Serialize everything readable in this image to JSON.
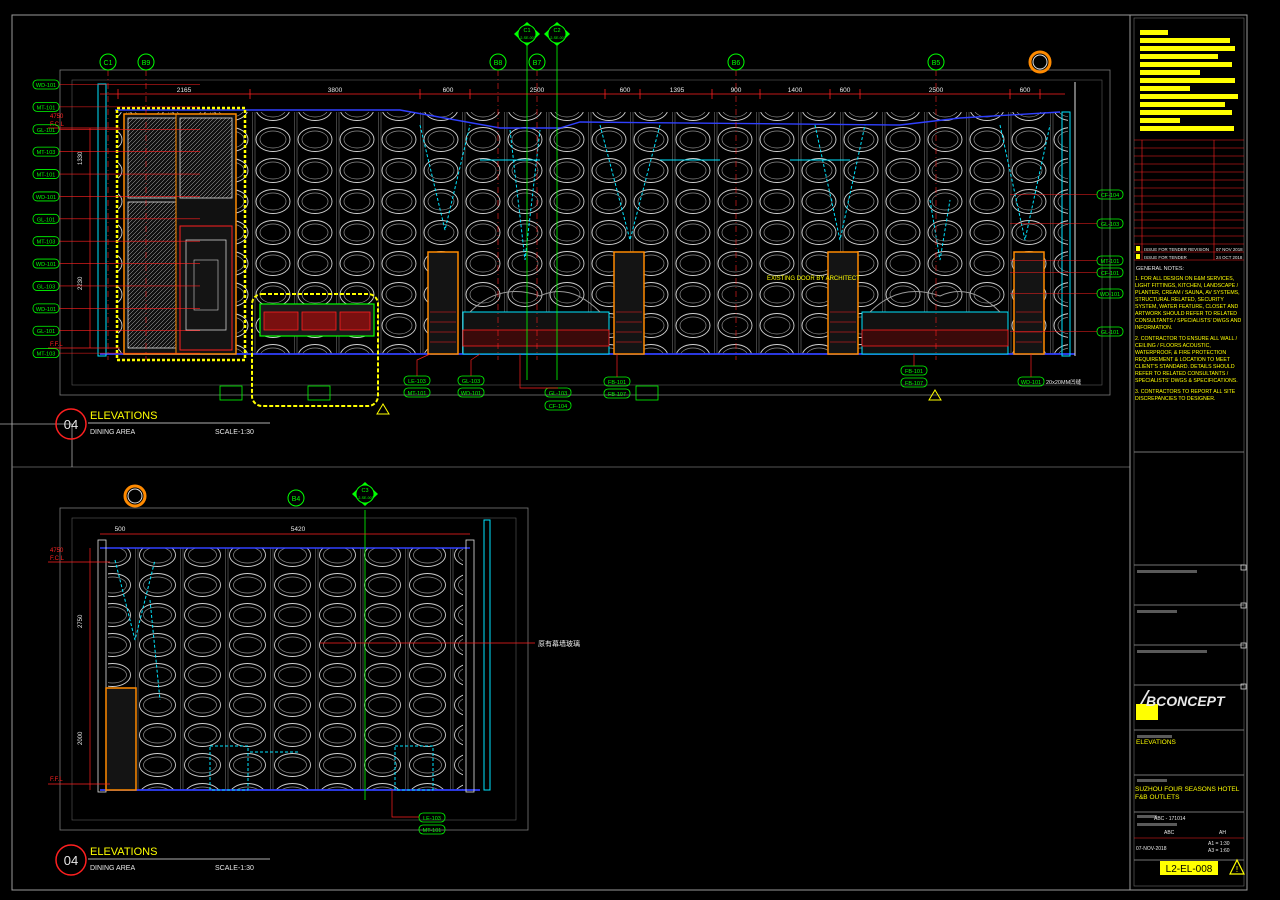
{
  "elevation_top": {
    "number": "04",
    "title": "ELEVATIONS",
    "subtitle": "DINING AREA",
    "scale": "SCALE-1:30",
    "grid_refs": [
      "C1",
      "B9",
      "B8",
      "B7",
      "B6",
      "B5"
    ],
    "dimensions": [
      "2165",
      "3800",
      "600",
      "2500",
      "600",
      "1395",
      "900",
      "1400",
      "600",
      "2500",
      "600"
    ],
    "level_labels": [
      "4750",
      "F.C.L",
      "F.F.L"
    ],
    "height_dims": [
      "1330",
      "2230"
    ],
    "section_markers": [
      {
        "id": "C1",
        "ref": "L2-SE-001"
      },
      {
        "id": "C2",
        "ref": "L2-SE-001"
      }
    ],
    "left_tags": [
      "WD-101",
      "MT-101",
      "GL-101",
      "MT-103",
      "MT-101",
      "WD-101",
      "GL-101",
      "MT-103",
      "WD-101",
      "GL-103",
      "WD-101",
      "GL-101",
      "MT-103"
    ],
    "right_tags": [
      "CF-104",
      "GL-103",
      "MT-101",
      "CF-101",
      "WD-101",
      "GL-101"
    ],
    "bottom_tags": [
      "LE-103",
      "MT-101",
      "GL-103",
      "WD-101",
      "GL-103",
      "CF-104",
      "FB-101",
      "FB-107",
      "FB-101",
      "FB-107",
      "WD-101"
    ],
    "annotation": "EXISTING DOOR BY ARCHITECT",
    "note_right": "20x20MM凹缝"
  },
  "elevation_bottom": {
    "number": "04",
    "title": "ELEVATIONS",
    "subtitle": "DINING AREA",
    "scale": "SCALE-1:30",
    "grid_refs": [
      "B4"
    ],
    "dimensions": [
      "500",
      "5420"
    ],
    "level_labels": [
      "4750",
      "F.C.L",
      "F.F.L"
    ],
    "height_dims": [
      "2750",
      "2000"
    ],
    "section_marker": {
      "id": "C3",
      "ref": "L2-SE-001"
    },
    "callout": "原有幕墙玻璃",
    "bottom_tags": [
      "LE-103",
      "MT-101"
    ]
  },
  "title_block": {
    "revisions": [
      {
        "label": "ISSUE FOR TENDER REVISION",
        "date": "07 NOV 2018"
      },
      {
        "label": "ISSUE FOR TENDER",
        "date": "24 OCT 2018"
      }
    ],
    "general_notes_title": "GENERAL NOTES:",
    "notes": [
      "1. FOR ALL DESIGN ON E&M SERVICES, LIGHT FITTINGS, KITCHEN, LANDSCAPE / PLANTER, CREAM / SAUNA, AV SYSTEMS, STRUCTURAL RELATED, SECURITY SYSTEM, WATER FEATURE, CLOSET AND ARTWORK SHOULD REFER TO RELATED CONSULTANTS / SPECIALISTS' DWGS AND INFORMATION.",
      "2. CONTRACTOR TO ENSURE ALL WALL / CEILING / FLOORS ACOUSTIC, WATERPROOF, & FIRE PROTECTION REQUIREMENT & LOCATION TO MEET CLIENT'S STANDARD. DETAILS SHOULD REFER TO RELATED CONSULTANTS / SPECIALISTS' DWGS & SPECIFICATIONS.",
      "3. CONTRACTORS TO REPORT ALL SITE DISCREPANCIES TO DESIGNER."
    ],
    "company": "BCONCEPT",
    "drawing_title": "ELEVATIONS",
    "project": "SUZHOU FOUR SEASONS HOTEL F&B OUTLETS",
    "project_no": "ABC - 171014",
    "drawn": "ABC",
    "checked": "AH",
    "date": "07-NOV-2018",
    "scale_a1": "A1 = 1:30",
    "scale_a3": "A3 = 1:60",
    "drawing_no": "L2-EL-008",
    "warn": "!"
  },
  "colors": {
    "bg": "#000000",
    "red": "#ff2020",
    "yellow": "#ffff00",
    "cyan": "#00e5ff",
    "green": "#00ff00",
    "white": "#e8e8e8",
    "gray": "#8c8c8c",
    "blue": "#3040ff",
    "orange": "#ff8a00"
  }
}
